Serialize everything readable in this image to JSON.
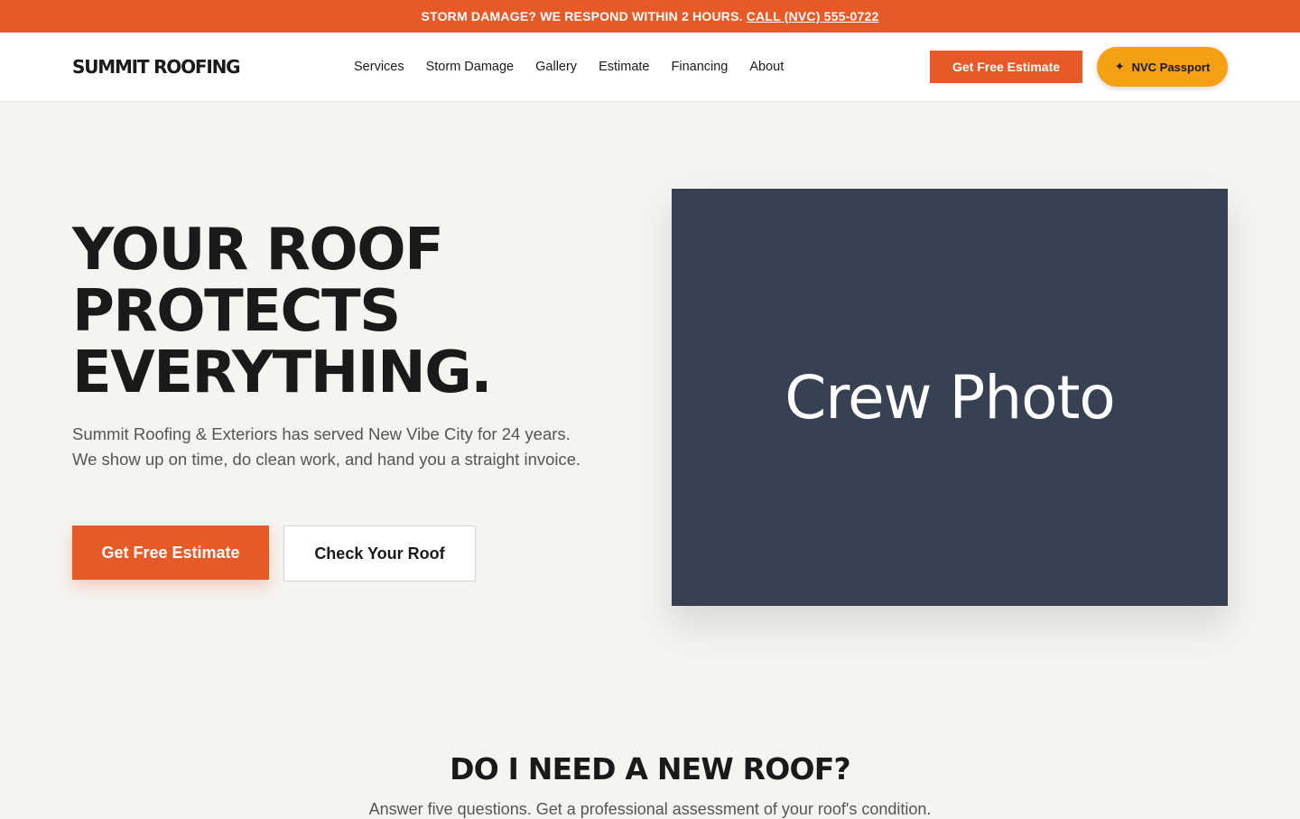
{
  "topbar": {
    "message": "STORM DAMAGE? WE RESPOND WITHIN 2 HOURS.",
    "call_link": "CALL (NVC) 555-0722"
  },
  "nav": {
    "logo": "SUMMIT ROOFING",
    "items": [
      {
        "label": "Services"
      },
      {
        "label": "Storm Damage"
      },
      {
        "label": "Gallery"
      },
      {
        "label": "Estimate"
      },
      {
        "label": "Financing"
      },
      {
        "label": "About"
      }
    ],
    "estimate_button": "Get Free Estimate",
    "passport_button": "NVC Passport",
    "passport_icon": "sparkle-icon"
  },
  "hero": {
    "headline": [
      "YOUR ROOF",
      "PROTECTS",
      "EVERYTHING."
    ],
    "lead": "Summit Roofing & Exteriors has served New Vibe City for 24 years. We show up on time, do clean work, and hand you a straight invoice.",
    "primary_cta": "Get Free Estimate",
    "secondary_cta": "Check Your Roof",
    "photo_placeholder": "Crew Photo"
  },
  "roof_check": {
    "title": "DO I NEED A NEW ROOF?",
    "subtitle": "Answer five questions. Get a professional assessment of your roof's condition."
  },
  "colors": {
    "accent": "#e65a28",
    "passport": "#f5a012",
    "photo_bg": "#384152",
    "page_bg": "#f5f4f1"
  }
}
